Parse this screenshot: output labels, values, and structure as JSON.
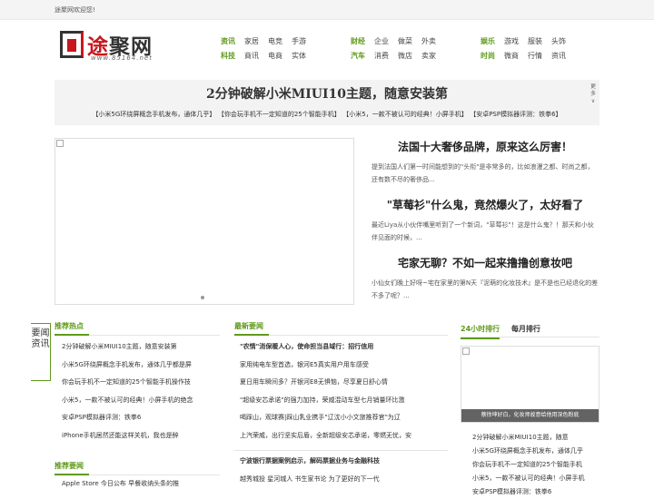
{
  "topbar": {
    "welcome": "途聚网欢迎您!"
  },
  "logo": {
    "text_a": "途",
    "text_b": "聚网",
    "url": "www.85164.net"
  },
  "nav": [
    {
      "rows": [
        [
          "资讯",
          "家居",
          "电竞",
          "手游"
        ],
        [
          "科技",
          "商讯",
          "电商",
          "实体"
        ]
      ]
    },
    {
      "rows": [
        [
          "财经",
          "企业",
          "做菜",
          "外卖"
        ],
        [
          "汽车",
          "消费",
          "微店",
          "卖家"
        ]
      ]
    },
    {
      "rows": [
        [
          "娱乐",
          "游戏",
          "服装",
          "头饰"
        ],
        [
          "时尚",
          "微商",
          "行情",
          "资讯"
        ]
      ]
    }
  ],
  "banner": {
    "title": "2分钟破解小米MIUI10主题，随意安装第",
    "links": [
      "【小米5G环绕屏概念手机发布，通体几乎】",
      "【你会玩手机不一定知道的25个智能手机】",
      "【小米5，一款不被认可的经典！小屏手机】",
      "【安卓PSP模拟器评测：铁拳6】"
    ],
    "more": "更多∨"
  },
  "stories": [
    {
      "title": "法国十大奢侈品牌，原来这么厉害！",
      "summary": "提到法国人们第一时间能想到的\"头衔\"是非常多的，比如浪漫之都、时尚之都，还有数不尽的奢侈品..."
    },
    {
      "title": "\"草莓衫\"什么鬼，竟然爆火了，太好看了",
      "summary": "最近Liya从小伙伴嘴里听到了一个新词，\"草莓衫\"！这是什么鬼？！那天和小伙伴见面的时候，..."
    },
    {
      "title": "宅家无聊？不如一起来撸撸创意妆吧",
      "summary": "小仙女们晚上好呀~宅在家里的第N天『泥萌的化妆技术』是不是也已经退化的差不多了呢？..."
    }
  ],
  "side_tab": "要闻资讯",
  "hot": {
    "heading": "推荐热点",
    "items": [
      "2分钟破解小米MIUI10主题，随意安装第",
      "小米5G环绕屏概念手机发布，通体几乎都是屏",
      "你会玩手机不一定知道的25个智能手机操作技",
      "小米5，一款不被认可的经典！小屏手机的绝念",
      "安卓PSP模拟器评测：铁拳6",
      "iPhone手机居然还能这样关机，我也是醉"
    ]
  },
  "recommend": {
    "heading": "推荐要闻",
    "items": [
      "Apple Store 今日公布 早餐收纳头条的推"
    ]
  },
  "latest": {
    "heading": "最新要闻",
    "items": [
      {
        "t": "\"农情\"消保暖人心，使命担当县域行：招行信用",
        "b": true
      },
      {
        "t": "家用纯电车型首选，银河E5真实用户用车感受",
        "b": false
      },
      {
        "t": "夏日用车瞬间多？开银河E8无惧恼，尽享夏日舒心情",
        "b": false
      },
      {
        "t": "\"超级安芯承诺\"的强力加持，荣威混动车型七月销量环比激",
        "b": false
      },
      {
        "t": "喝踩山，观球赛|踩山乳业携手\"辽沈小小文旅推荐官\"为辽",
        "b": false
      },
      {
        "t": "上汽荣威，出行坚实后盾，全新超级安芯承诺，零燃无忧，安",
        "b": false
      }
    ],
    "items2": [
      {
        "t": "宁波银行票据案例启示，解码票据业务与金融科技",
        "b": true
      },
      {
        "t": "越秀城投 星河城人 书生家书论 为了更好的下一代",
        "b": false
      }
    ]
  },
  "ranking": {
    "tabs": [
      "24小时排行",
      "每月排行"
    ],
    "caption": "蔡徐坤好白，化妆师故意给他用深色粉底",
    "items": [
      "2分钟破解小米MIUI10主题，随意",
      "小米5G环绕屏概念手机发布，通体几乎",
      "你会玩手机不一定知道的25个智能手机",
      "小米5，一款不被认可的经典！小屏手机",
      "安卓PSP模拟器评测：铁拳6"
    ]
  }
}
